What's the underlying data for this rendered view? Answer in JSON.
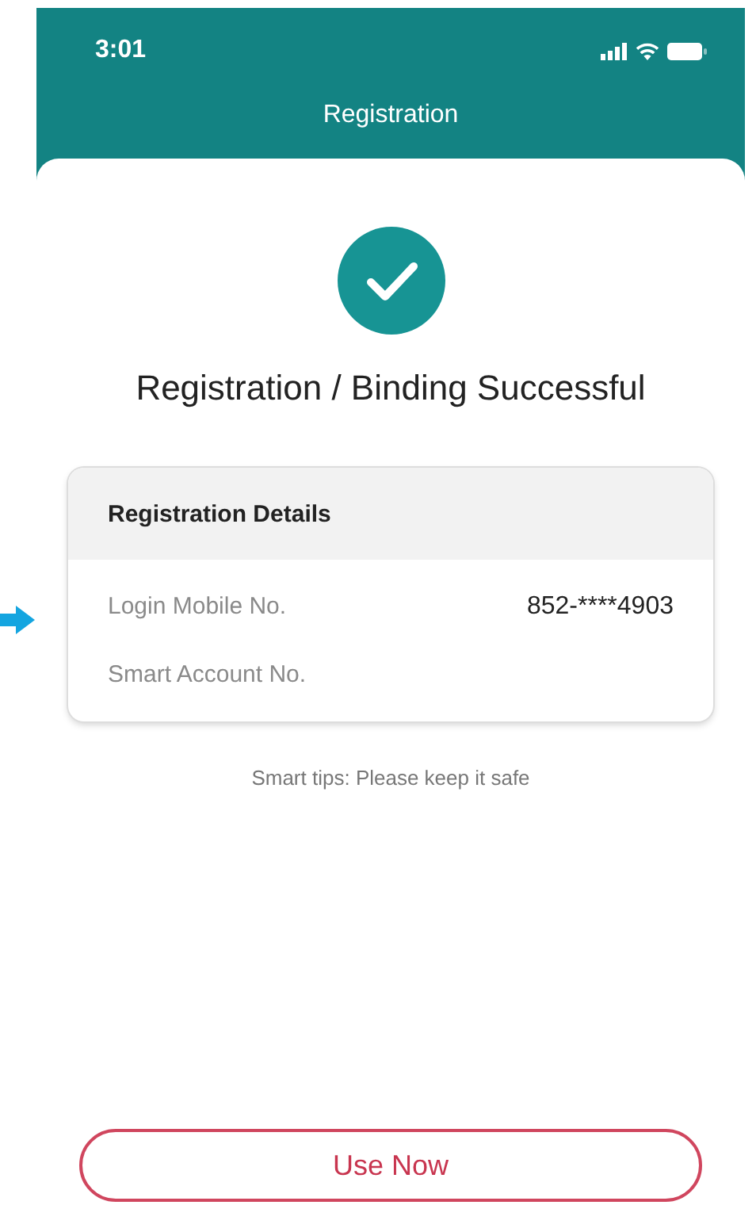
{
  "status_bar": {
    "time": "3:01"
  },
  "header": {
    "title": "Registration"
  },
  "result": {
    "kind": "success",
    "message": "Registration / Binding Successful"
  },
  "details_card": {
    "title": "Registration Details",
    "rows": [
      {
        "label": "Login Mobile No.",
        "value": "852-****4903"
      },
      {
        "label": "Smart Account No."
      }
    ]
  },
  "tip": "Smart tips: Please keep it safe",
  "primary_button": {
    "label": "Use Now"
  },
  "annotation": {
    "kind": "arrow"
  }
}
